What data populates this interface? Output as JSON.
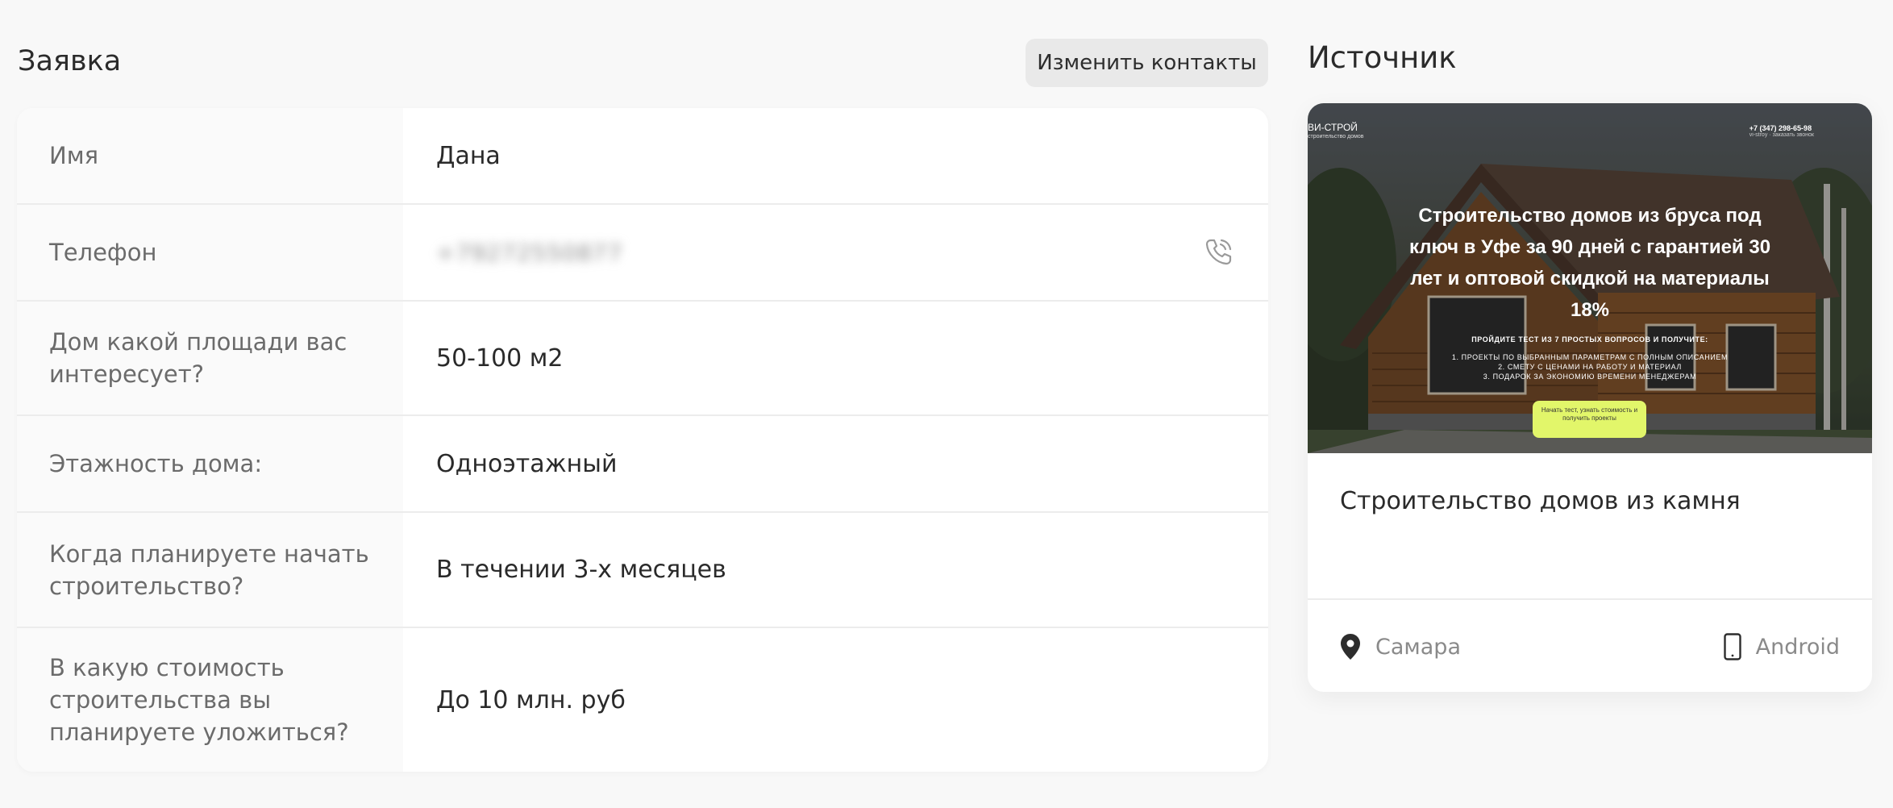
{
  "request": {
    "title": "Заявка",
    "edit_contacts_label": "Изменить контакты",
    "fields": [
      {
        "label": "Имя",
        "value": "Дана"
      },
      {
        "label": "Телефон",
        "value": "+79272550877"
      },
      {
        "label": "Дом какой площади вас интересует?",
        "value": "50-100 м2"
      },
      {
        "label": "Этажность дома:",
        "value": "Одноэтажный"
      },
      {
        "label": "Когда планируете начать строительство?",
        "value": "В течении 3-х месяцев"
      },
      {
        "label": "В какую стоимость строительства вы планируете уложиться?",
        "value": "До 10 млн. руб"
      }
    ]
  },
  "source": {
    "title": "Источник",
    "preview": {
      "brand": "ВИ-СТРОЙ",
      "brand_sub": "строительство домов",
      "phone": "+7 (347) 298-65-98",
      "phone_sub": "vi-stroy · заказать звонок",
      "heading": "Строительство домов из бруса под ключ в Уфе за 90 дней с гарантией 30 лет и оптовой скидкой на материалы 18%",
      "subheading": "ПРОЙДИТЕ ТЕСТ ИЗ 7 ПРОСТЫХ ВОПРОСОВ И ПОЛУЧИТЕ:",
      "list": [
        "1. ПРОЕКТЫ ПО ВЫБРАННЫМ ПАРАМЕТРАМ С ПОЛНЫМ ОПИСАНИЕМ",
        "2. СМЕТУ С ЦЕНАМИ НА РАБОТУ И МАТЕРИАЛ",
        "3. ПОДАРОК ЗА ЭКОНОМИЮ ВРЕМЕНИ МЕНЕДЖЕРАМ"
      ],
      "cta": "Начать тест, узнать стоимость и получить проекты"
    },
    "name": "Строительство домов из камня",
    "city": "Самара",
    "device": "Android"
  },
  "icons": {
    "call": "phone-call-icon",
    "location": "location-pin-icon",
    "device": "smartphone-icon"
  }
}
